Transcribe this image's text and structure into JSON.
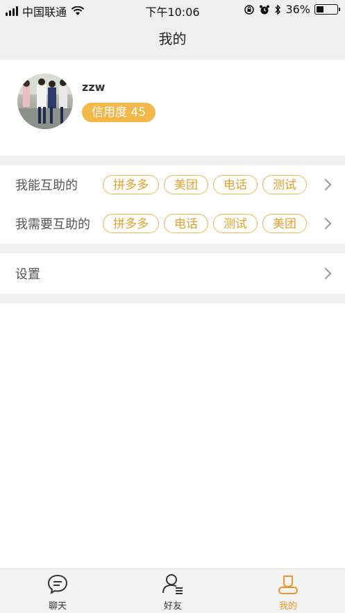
{
  "status": {
    "carrier": "中国联通",
    "time": "下午10:06",
    "battery": "36%",
    "battery_level": 0.36
  },
  "nav": {
    "title": "我的"
  },
  "profile": {
    "username": "zzw",
    "credit_label": "信用度 45"
  },
  "help": {
    "can": {
      "label": "我能互助的",
      "tags": [
        "拼多多",
        "美团",
        "电话",
        "测试"
      ]
    },
    "need": {
      "label": "我需要互助的",
      "tags": [
        "拼多多",
        "电话",
        "测试",
        "美团"
      ]
    }
  },
  "settings": {
    "label": "设置"
  },
  "tabbar": {
    "items": [
      {
        "label": "聊天",
        "icon": "chat-bubble-icon"
      },
      {
        "label": "好友",
        "icon": "friends-icon"
      },
      {
        "label": "我的",
        "icon": "profile-icon",
        "active": true
      }
    ],
    "active_color": "#f0932b"
  },
  "colors": {
    "accent": "#f3b84a",
    "tag_text": "#e3a02b",
    "background_gray": "#efefef"
  }
}
